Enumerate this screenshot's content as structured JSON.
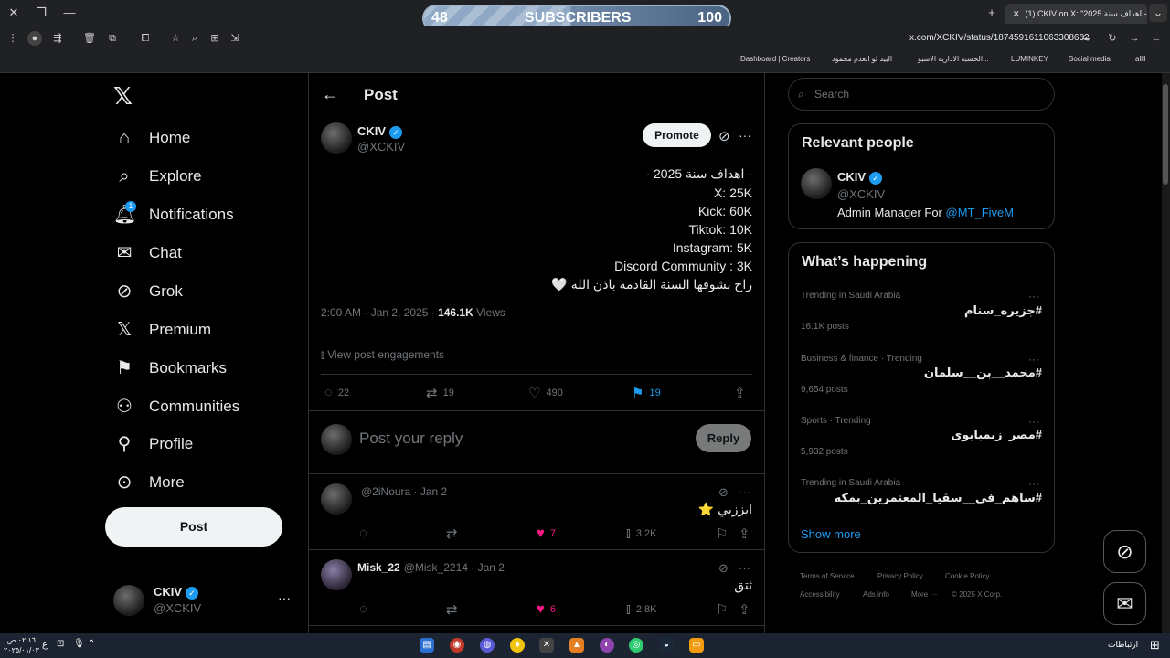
{
  "overlay": {
    "left_value": "48",
    "label": "SUBSCRIBERS",
    "right_value": "100",
    "fraction": 0.48
  },
  "browser": {
    "tab_title": "(1) CKIV on X: \"اهداف سنة 2025 -",
    "url": "x.com/XCKIV/status/1874591611063308662",
    "bookmarks": [
      "Dashboard | Creators",
      "البيد لو انعدم محمود",
      "الحسبة الادارية الاسبو...",
      "LUMINKEY",
      "Social media",
      "allll"
    ]
  },
  "nav": {
    "items": [
      {
        "label": "Home",
        "icon": "home-icon"
      },
      {
        "label": "Explore",
        "icon": "search-icon"
      },
      {
        "label": "Notifications",
        "icon": "bell-icon",
        "badge": "1"
      },
      {
        "label": "Chat",
        "icon": "mail-icon"
      },
      {
        "label": "Grok",
        "icon": "grok-icon"
      },
      {
        "label": "Premium",
        "icon": "x-logo-icon"
      },
      {
        "label": "Bookmarks",
        "icon": "bookmark-icon"
      },
      {
        "label": "Communities",
        "icon": "people-icon"
      },
      {
        "label": "Profile",
        "icon": "person-icon"
      },
      {
        "label": "More",
        "icon": "more-circle-icon"
      }
    ],
    "post_button": "Post",
    "account": {
      "name": "CKIV",
      "handle": "@XCKIV"
    }
  },
  "header": {
    "title": "Post"
  },
  "tweet": {
    "name": "CKIV",
    "handle": "@XCKIV",
    "promote": "Promote",
    "lines": [
      "- اهداف سنة 2025 -",
      "X: 25K",
      "Kick: 60K",
      "Tiktok: 10K",
      "Instagram: 5K",
      "Discord Community : 3K",
      "راح نشوفها السنة القادمه باذن الله 🤍"
    ],
    "time": "2:00 AM · Jan 2, 2025 · ",
    "views_count": "146.1K",
    "views_label": " Views",
    "engagements": "View post engagements",
    "replies": "22",
    "reposts": "19",
    "likes": "490",
    "bookmarks": "19"
  },
  "reply_box": {
    "placeholder": "Post your reply",
    "button": "Reply"
  },
  "replies": [
    {
      "name": "",
      "handle": "@2iNoura · Jan 2",
      "text": "ايززيي ⭐",
      "likes": "7",
      "views": "3.2K"
    },
    {
      "name": "Misk_22",
      "handle": "@Misk_2214 · Jan 2",
      "text": "ثتق",
      "likes": "6",
      "views": "2.8K"
    }
  ],
  "search": {
    "placeholder": "Search"
  },
  "relevant": {
    "title": "Relevant people",
    "name": "CKIV",
    "handle": "@XCKIV",
    "bio_prefix": "Admin Manager For ",
    "bio_link": "@MT_FiveM"
  },
  "happening": {
    "title": "What’s happening",
    "trends": [
      {
        "meta": "Trending in Saudi Arabia",
        "name": "#جزيره_سنام",
        "posts": "16.1K posts"
      },
      {
        "meta": "Business & finance · Trending",
        "name": "#محمد__بن__سلمان",
        "posts": "9,654 posts"
      },
      {
        "meta": "Sports · Trending",
        "name": "#مصر_زيمبابوى",
        "posts": "5,932 posts"
      },
      {
        "meta": "Trending in Saudi Arabia",
        "name": "#ساهم_في__سقيا_المعتمرين_بمكه",
        "posts": ""
      }
    ],
    "show_more": "Show more"
  },
  "footer": {
    "terms": "Terms of Service",
    "privacy": "Privacy Policy",
    "cookie": "Cookie Policy",
    "accessibility": "Accessibility",
    "ads": "Ads info",
    "more": "More ···",
    "copyright": "© 2025 X Corp."
  },
  "taskbar": {
    "clock_time": "٠٢:١٦ ص",
    "clock_date": "٢٠٢٥/٠١/٠٣",
    "lang": "ع",
    "start_label": "ارتباطات"
  }
}
